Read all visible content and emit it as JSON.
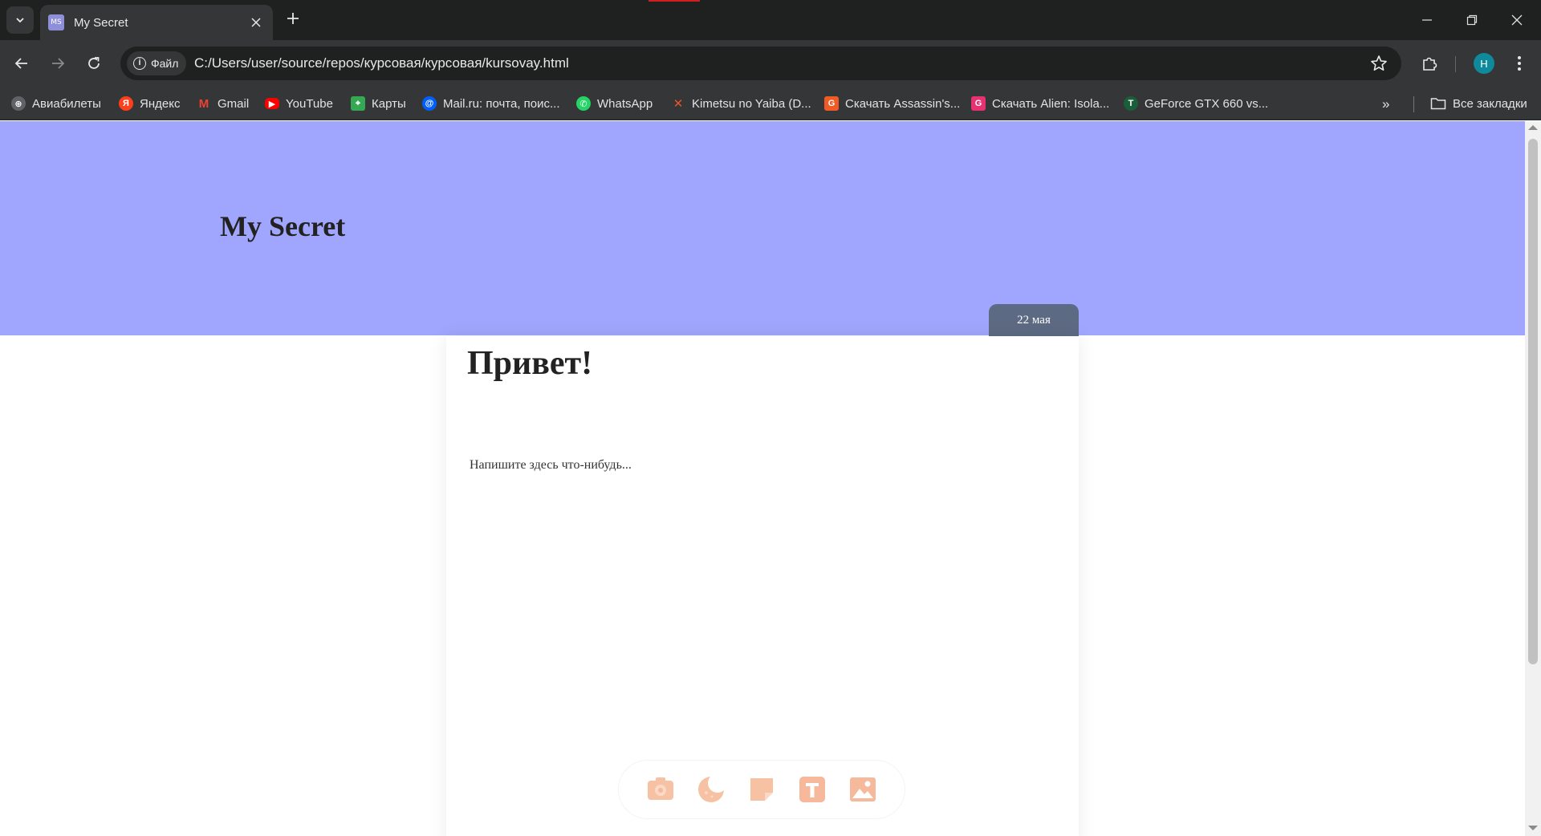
{
  "browser": {
    "tab_title": "My Secret",
    "tab_favicon_text": "MS",
    "site_chip_label": "Файл",
    "url": "C:/Users/user/source/repos/курсовая/курсовая/kursovay.html",
    "profile_initial": "H"
  },
  "bookmarks": [
    {
      "label": "Авиабилеты",
      "icon": "globe-icon",
      "color": "#6b6b6b"
    },
    {
      "label": "Яндекс",
      "icon": "yandex-icon",
      "color": "#fc3f1d"
    },
    {
      "label": "Gmail",
      "icon": "gmail-icon",
      "color": "#ea4335"
    },
    {
      "label": "YouTube",
      "icon": "youtube-icon",
      "color": "#ff0000"
    },
    {
      "label": "Карты",
      "icon": "maps-icon",
      "color": "#34a853"
    },
    {
      "label": "Mail.ru: почта, поис...",
      "icon": "mailru-icon",
      "color": "#005ff9"
    },
    {
      "label": "WhatsApp",
      "icon": "whatsapp-icon",
      "color": "#25d366"
    },
    {
      "label": "Kimetsu no Yaiba (D...",
      "icon": "kimetsu-icon",
      "color": "#e8552b"
    },
    {
      "label": "Скачать Assassin's...",
      "icon": "game-icon",
      "color": "#f05a24"
    },
    {
      "label": "Скачать Alien: Isola...",
      "icon": "game-icon",
      "color": "#e8326f"
    },
    {
      "label": "GeForce GTX 660 vs...",
      "icon": "techpowerup-icon",
      "color": "#1b5e3a"
    }
  ],
  "all_bookmarks_label": "Все закладки",
  "page": {
    "site_title": "My Secret",
    "date_label": "22 мая",
    "post_heading": "Привет!",
    "post_placeholder": "Напишите здесь что-нибудь...",
    "header_color": "#a0a6fd",
    "date_tab_color": "#5d6a83",
    "tool_icon_color": "#f7b99b",
    "tools": [
      {
        "name": "camera-settings-icon"
      },
      {
        "name": "moon-icon"
      },
      {
        "name": "sticky-note-icon"
      },
      {
        "name": "text-icon"
      },
      {
        "name": "image-icon"
      }
    ]
  }
}
